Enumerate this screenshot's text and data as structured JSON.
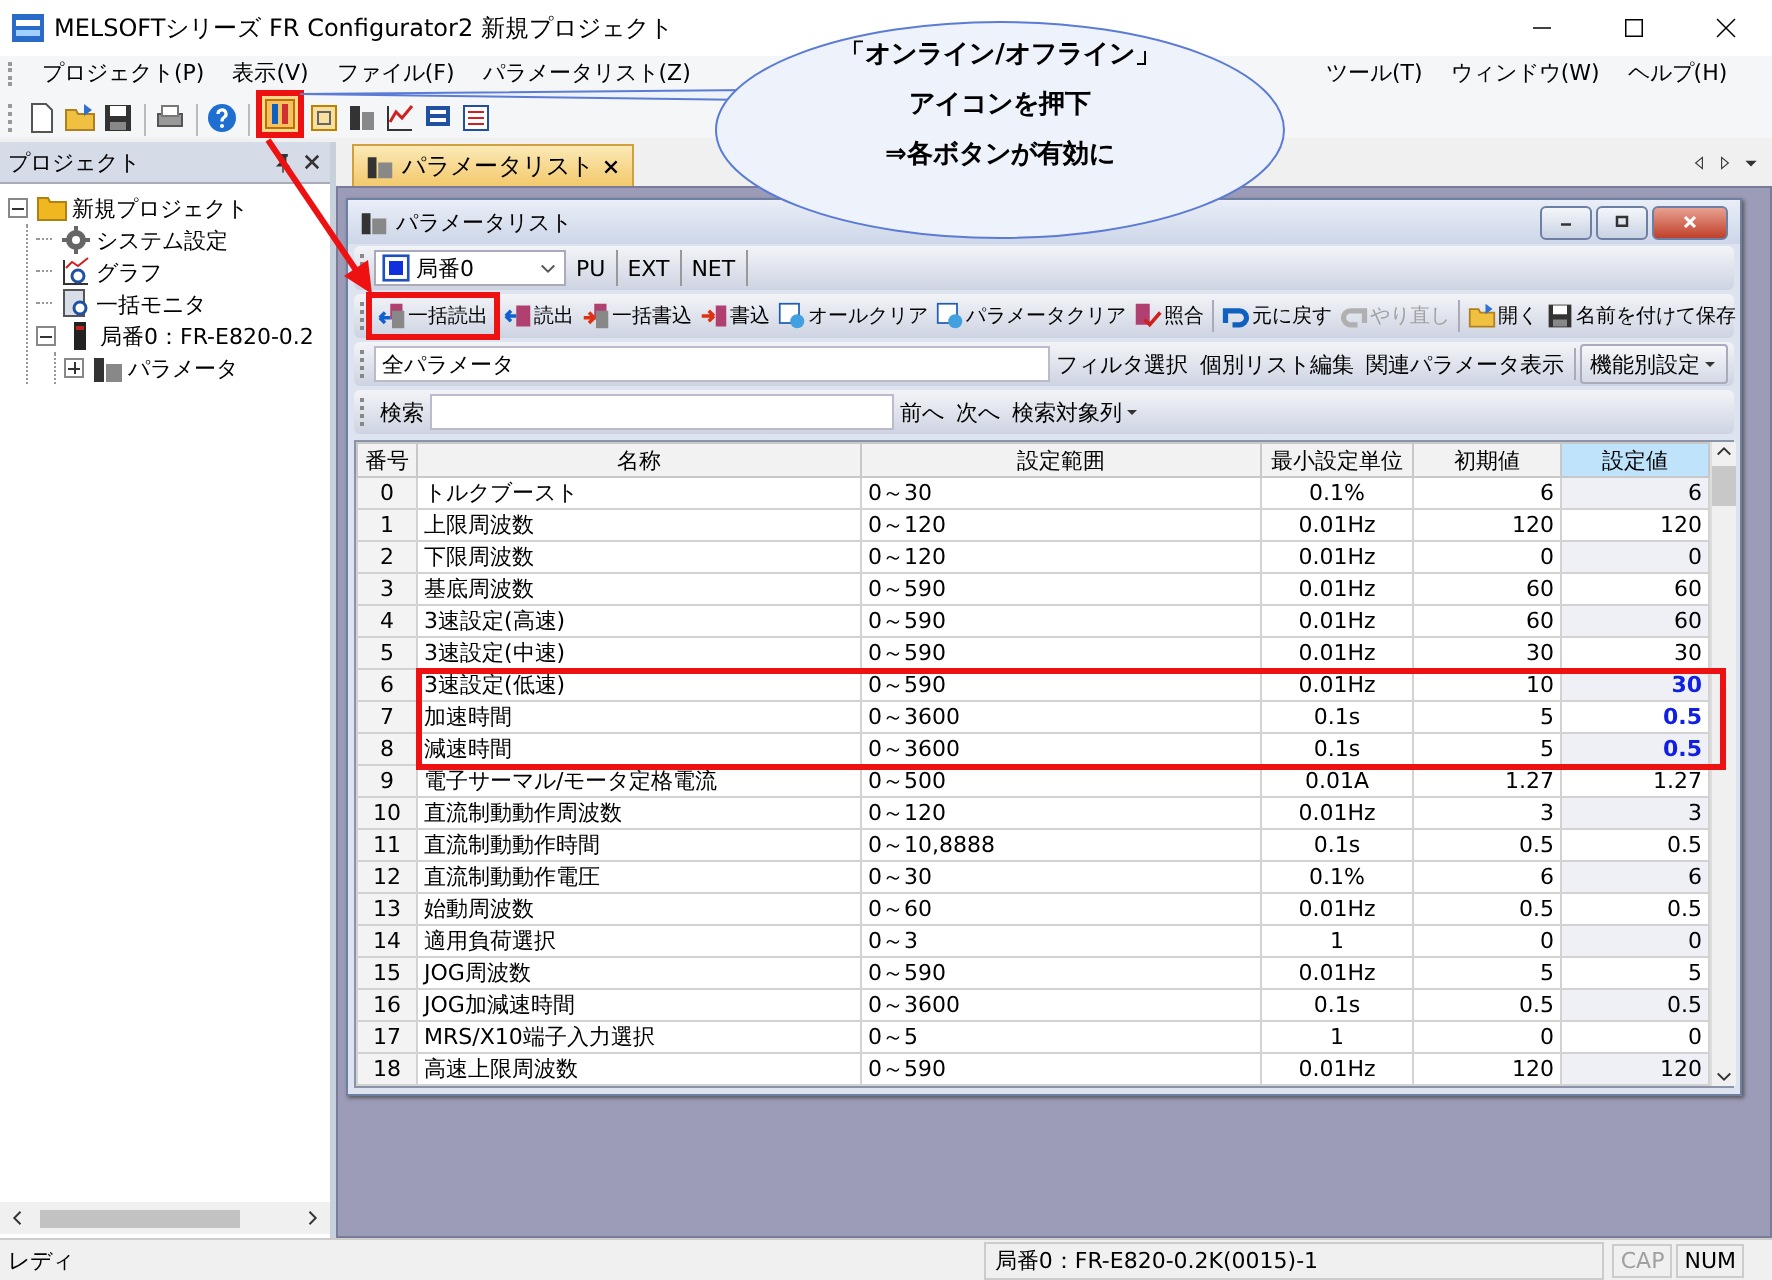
{
  "window": {
    "title": "MELSOFTシリーズ FR Configurator2 新規プロジェクト"
  },
  "menu_bar": {
    "items_left": [
      "プロジェクト(P)",
      "表示(V)",
      "ファイル(F)",
      "パラメータリスト(Z)"
    ],
    "items_right": [
      "ツール(T)",
      "ウィンドウ(W)",
      "ヘルプ(H)"
    ]
  },
  "toolbar": [
    {
      "highlighted": false
    },
    {
      "highlighted": false
    },
    {
      "highlighted": false
    },
    {
      "highlighted": false
    },
    {
      "highlighted": false
    },
    {
      "highlighted": true
    },
    {
      "highlighted": false
    },
    {
      "highlighted": false
    },
    {
      "highlighted": false
    },
    {
      "highlighted": false
    },
    {
      "highlighted": false
    }
  ],
  "project_panel": {
    "title": "プロジェクト",
    "tree": [
      {
        "label": "新規プロジェクト",
        "kind": "project",
        "expanded": true,
        "children": [
          {
            "label": "システム設定",
            "kind": "settings"
          },
          {
            "label": "グラフ",
            "kind": "graph"
          },
          {
            "label": "一括モニタ",
            "kind": "monitor"
          },
          {
            "label": "局番0：FR-E820-0.2",
            "kind": "station",
            "expanded": true,
            "children": [
              {
                "label": "パラメータ",
                "kind": "parameters",
                "expanded": false
              }
            ]
          }
        ]
      }
    ]
  },
  "tabs": [
    {
      "label": "パラメータリスト",
      "selected": true
    }
  ],
  "param_window": {
    "title": "パラメータリスト",
    "station": "局番0",
    "mode_buttons": [
      "PU",
      "EXT",
      "NET"
    ],
    "button_groups": [
      [
        {
          "label": "一括読出",
          "kind": "batch-read",
          "highlighted": true,
          "disabled": false
        },
        {
          "label": "読出",
          "kind": "read",
          "highlighted": false,
          "disabled": false
        },
        {
          "label": "一括書込",
          "kind": "batch-write",
          "highlighted": false,
          "disabled": false
        },
        {
          "label": "書込",
          "kind": "write",
          "highlighted": false,
          "disabled": false
        },
        {
          "label": "オールクリア",
          "kind": "all-clear",
          "highlighted": false,
          "disabled": false
        },
        {
          "label": "パラメータクリア",
          "kind": "param-clear",
          "highlighted": false,
          "disabled": false
        },
        {
          "label": "照合",
          "kind": "verify",
          "highlighted": false,
          "disabled": false
        }
      ],
      [
        {
          "label": "元に戻す",
          "kind": "undo",
          "highlighted": false,
          "disabled": false
        },
        {
          "label": "やり直し",
          "kind": "redo",
          "highlighted": false,
          "disabled": true
        }
      ],
      [
        {
          "label": "開く",
          "kind": "open",
          "highlighted": false,
          "disabled": false
        },
        {
          "label": "名前を付けて保存",
          "kind": "save",
          "highlighted": false,
          "disabled": false
        }
      ]
    ],
    "filter_field": "全パラメータ",
    "filter_buttons": [
      "フィルタ選択",
      "個別リスト編集",
      "関連パラメータ表示"
    ],
    "function_menu": "機能別設定",
    "search_label": "検索",
    "search_buttons": [
      "前へ",
      "次へ"
    ],
    "search_column_menu": "検索対象列"
  },
  "table": {
    "columns": [
      {
        "label": "番号",
        "selected": false
      },
      {
        "label": "名称",
        "selected": false
      },
      {
        "label": "設定範囲",
        "selected": false
      },
      {
        "label": "最小設定単位",
        "selected": false
      },
      {
        "label": "初期値",
        "selected": false
      },
      {
        "label": "設定値",
        "selected": true
      }
    ],
    "rows": [
      {
        "no": "0",
        "name": "トルクブースト",
        "range": "0～30",
        "unit": "0.1%",
        "initial": "6",
        "value": "6",
        "changed": false,
        "highlighted": false
      },
      {
        "no": "1",
        "name": "上限周波数",
        "range": "0～120",
        "unit": "0.01Hz",
        "initial": "120",
        "value": "120",
        "changed": false,
        "highlighted": false
      },
      {
        "no": "2",
        "name": "下限周波数",
        "range": "0～120",
        "unit": "0.01Hz",
        "initial": "0",
        "value": "0",
        "changed": false,
        "highlighted": false
      },
      {
        "no": "3",
        "name": "基底周波数",
        "range": "0～590",
        "unit": "0.01Hz",
        "initial": "60",
        "value": "60",
        "changed": false,
        "highlighted": false
      },
      {
        "no": "4",
        "name": "3速設定(高速)",
        "range": "0～590",
        "unit": "0.01Hz",
        "initial": "60",
        "value": "60",
        "changed": false,
        "highlighted": false
      },
      {
        "no": "5",
        "name": "3速設定(中速)",
        "range": "0～590",
        "unit": "0.01Hz",
        "initial": "30",
        "value": "30",
        "changed": false,
        "highlighted": false
      },
      {
        "no": "6",
        "name": "3速設定(低速)",
        "range": "0～590",
        "unit": "0.01Hz",
        "initial": "10",
        "value": "30",
        "changed": true,
        "highlighted": true
      },
      {
        "no": "7",
        "name": "加速時間",
        "range": "0～3600",
        "unit": "0.1s",
        "initial": "5",
        "value": "0.5",
        "changed": true,
        "highlighted": true
      },
      {
        "no": "8",
        "name": "減速時間",
        "range": "0～3600",
        "unit": "0.1s",
        "initial": "5",
        "value": "0.5",
        "changed": true,
        "highlighted": true
      },
      {
        "no": "9",
        "name": "電子サーマル/モータ定格電流",
        "range": "0～500",
        "unit": "0.01A",
        "initial": "1.27",
        "value": "1.27",
        "changed": false,
        "highlighted": false
      },
      {
        "no": "10",
        "name": "直流制動動作周波数",
        "range": "0～120",
        "unit": "0.01Hz",
        "initial": "3",
        "value": "3",
        "changed": false,
        "highlighted": false
      },
      {
        "no": "11",
        "name": "直流制動動作時間",
        "range": "0～10,8888",
        "unit": "0.1s",
        "initial": "0.5",
        "value": "0.5",
        "changed": false,
        "highlighted": false
      },
      {
        "no": "12",
        "name": "直流制動動作電圧",
        "range": "0～30",
        "unit": "0.1%",
        "initial": "6",
        "value": "6",
        "changed": false,
        "highlighted": false
      },
      {
        "no": "13",
        "name": "始動周波数",
        "range": "0～60",
        "unit": "0.01Hz",
        "initial": "0.5",
        "value": "0.5",
        "changed": false,
        "highlighted": false
      },
      {
        "no": "14",
        "name": "適用負荷選択",
        "range": "0～3",
        "unit": "1",
        "initial": "0",
        "value": "0",
        "changed": false,
        "highlighted": false
      },
      {
        "no": "15",
        "name": "JOG周波数",
        "range": "0～590",
        "unit": "0.01Hz",
        "initial": "5",
        "value": "5",
        "changed": false,
        "highlighted": false
      },
      {
        "no": "16",
        "name": "JOG加減速時間",
        "range": "0～3600",
        "unit": "0.1s",
        "initial": "0.5",
        "value": "0.5",
        "changed": false,
        "highlighted": false
      },
      {
        "no": "17",
        "name": "MRS/X10端子入力選択",
        "range": "0～5",
        "unit": "1",
        "initial": "0",
        "value": "0",
        "changed": false,
        "highlighted": false
      },
      {
        "no": "18",
        "name": "高速上限周波数",
        "range": "0～590",
        "unit": "0.01Hz",
        "initial": "120",
        "value": "120",
        "changed": false,
        "highlighted": false
      }
    ]
  },
  "callout": {
    "lines": [
      "「オンライン/オフライン」",
      "アイコンを押下",
      "⇒各ボタンが有効に"
    ]
  },
  "status_bar": {
    "message": "レディ",
    "station": "局番0：FR-E820-0.2K(0015)-1",
    "indicators": [
      {
        "label": "CAP",
        "on": false
      },
      {
        "label": "NUM",
        "on": true
      }
    ]
  }
}
